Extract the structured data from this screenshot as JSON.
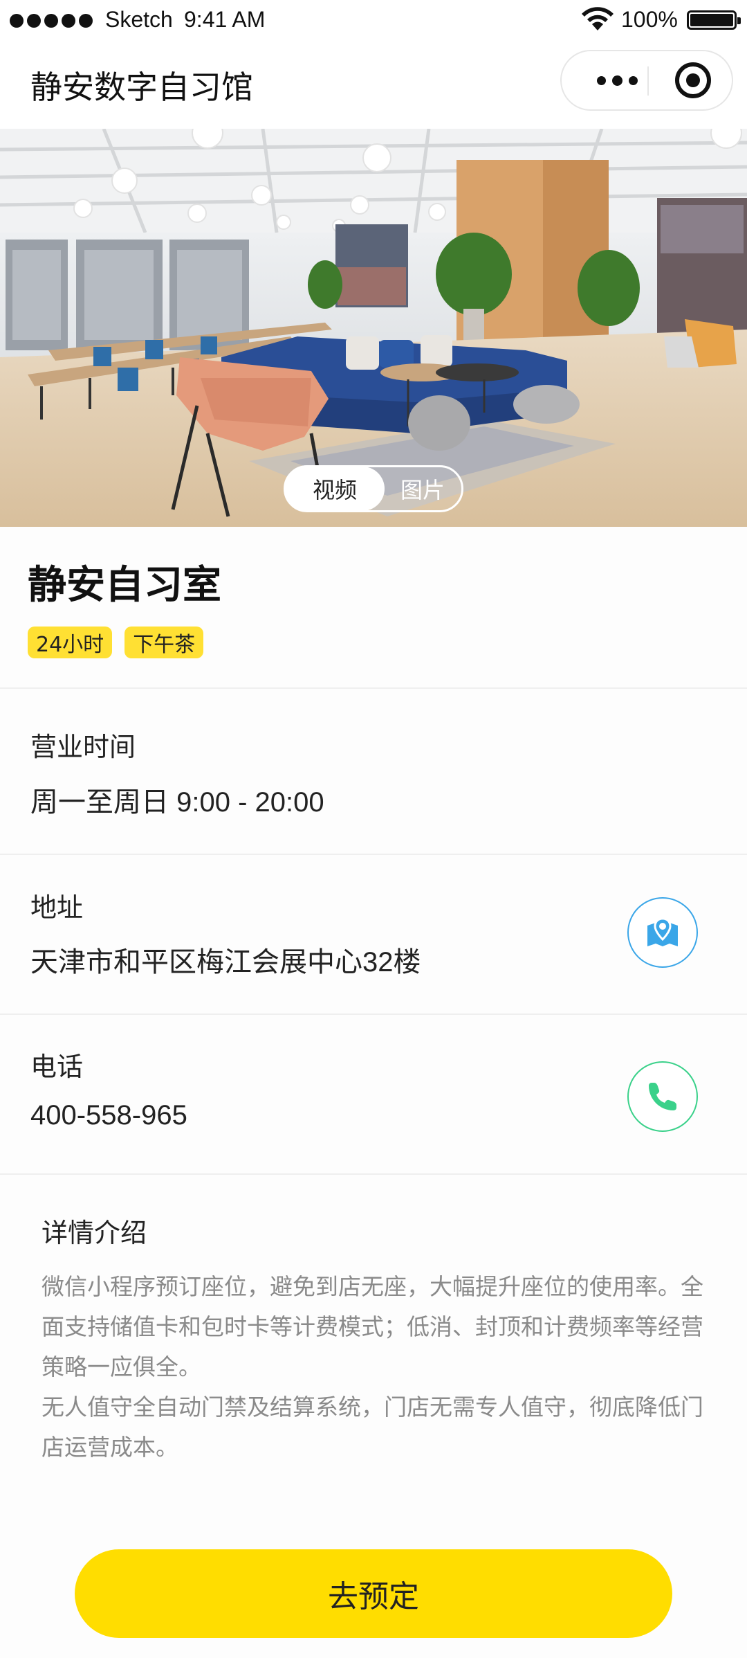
{
  "status_bar": {
    "carrier": "Sketch",
    "time": "9:41 AM",
    "battery": "100%"
  },
  "nav": {
    "title": "静安数字自习馆"
  },
  "hero": {
    "toggle": {
      "video": "视频",
      "photo": "图片",
      "selected": "视频"
    }
  },
  "store": {
    "name": "静安自习室",
    "tags": [
      "24小时",
      "下午茶"
    ]
  },
  "hours": {
    "label": "营业时间",
    "value": "周一至周日 9:00 - 20:00"
  },
  "address": {
    "label": "地址",
    "value": "天津市和平区梅江会展中心32楼"
  },
  "phone": {
    "label": "电话",
    "value": "400-558-965"
  },
  "detail": {
    "title": "详情介绍",
    "paragraph1": "微信小程序预订座位，避免到店无座，大幅提升座位的使用率。全面支持储值卡和包时卡等计费模式；低消、封顶和计费频率等经营策略一应俱全。",
    "paragraph2": "无人值守全自动门禁及结算系统，门店无需专人值守，彻底降低门店运营成本。"
  },
  "book_button": "去预定",
  "colors": {
    "accent_yellow": "#ffdd00",
    "tag_yellow": "#ffe033",
    "map_blue": "#3aa6e8",
    "phone_green": "#3ad18a"
  },
  "icons": [
    "wifi-icon",
    "battery-icon",
    "more-icon",
    "target-icon",
    "map-icon",
    "phone-icon"
  ]
}
